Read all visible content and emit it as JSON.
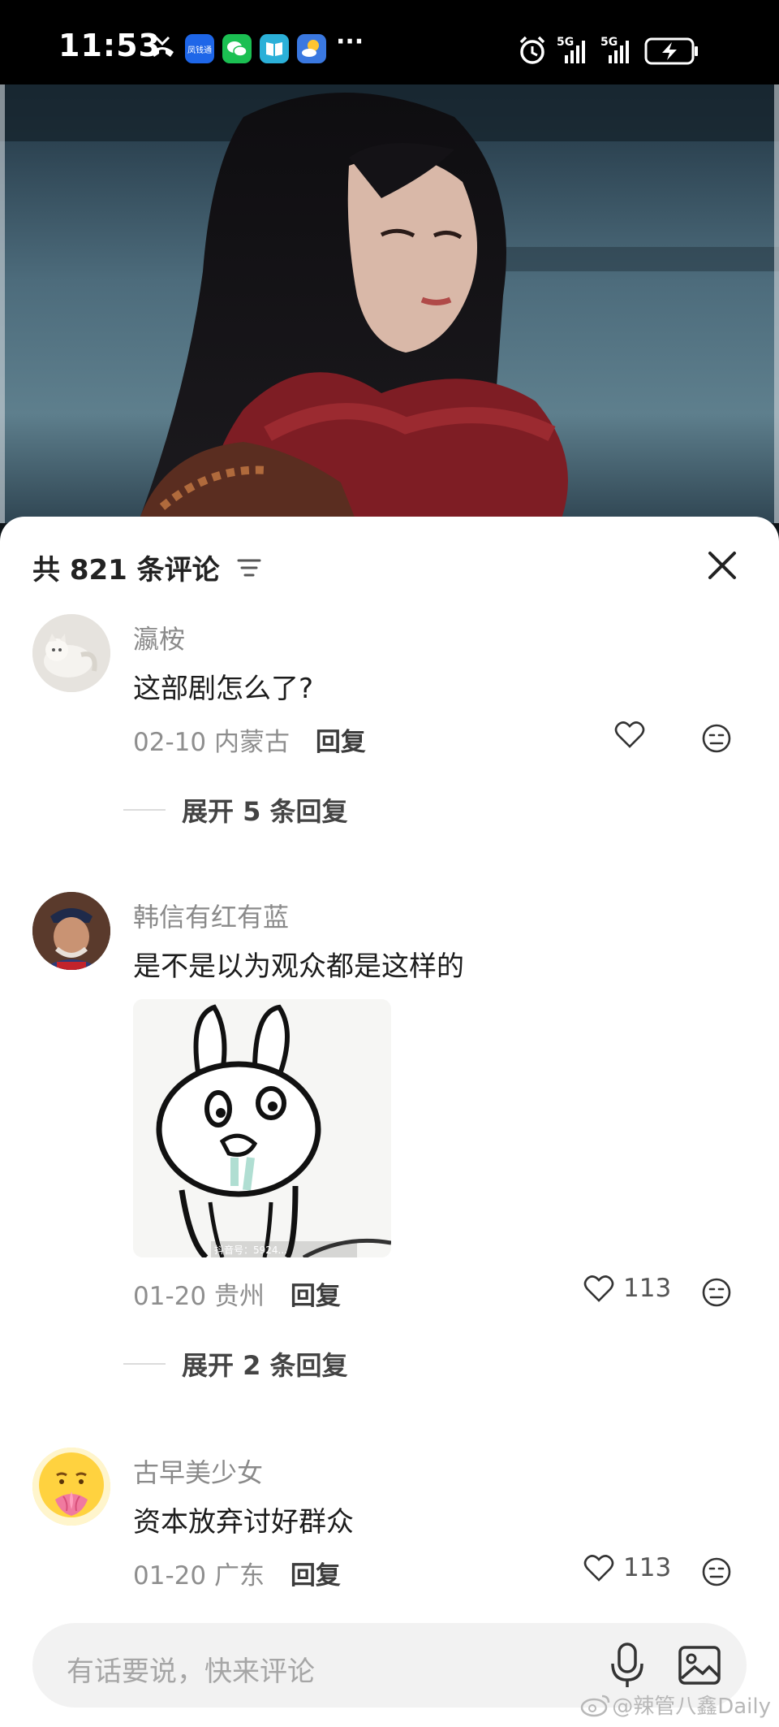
{
  "status_bar": {
    "time": "11:53",
    "more": "···",
    "signal_1": "5G",
    "signal_2": "5G",
    "app_icon_label": "凤钱通"
  },
  "comments_panel": {
    "title": "共 821 条评论",
    "filter_icon": "filter-icon",
    "close_icon": "close-icon"
  },
  "comments": [
    {
      "username": "瀛桉",
      "text": "这部剧怎么了?",
      "date": "02-10",
      "location": "内蒙古",
      "reply_label": "回复",
      "likes": "",
      "expand_label": "展开 5 条回复"
    },
    {
      "username": "韩信有红有蓝",
      "text": "是不是以为观众都是这样的",
      "date": "01-20",
      "location": "贵州",
      "reply_label": "回复",
      "likes": "113",
      "expand_label": "展开 2 条回复",
      "sticker_caption": "抖音号：5924..."
    },
    {
      "username": "古早美少女",
      "text": "资本放弃讨好群众",
      "date": "01-20",
      "location": "广东",
      "reply_label": "回复",
      "likes": "113"
    }
  ],
  "input": {
    "placeholder": "有话要说，快来评论"
  },
  "watermark": "@辣管八鑫Daily"
}
